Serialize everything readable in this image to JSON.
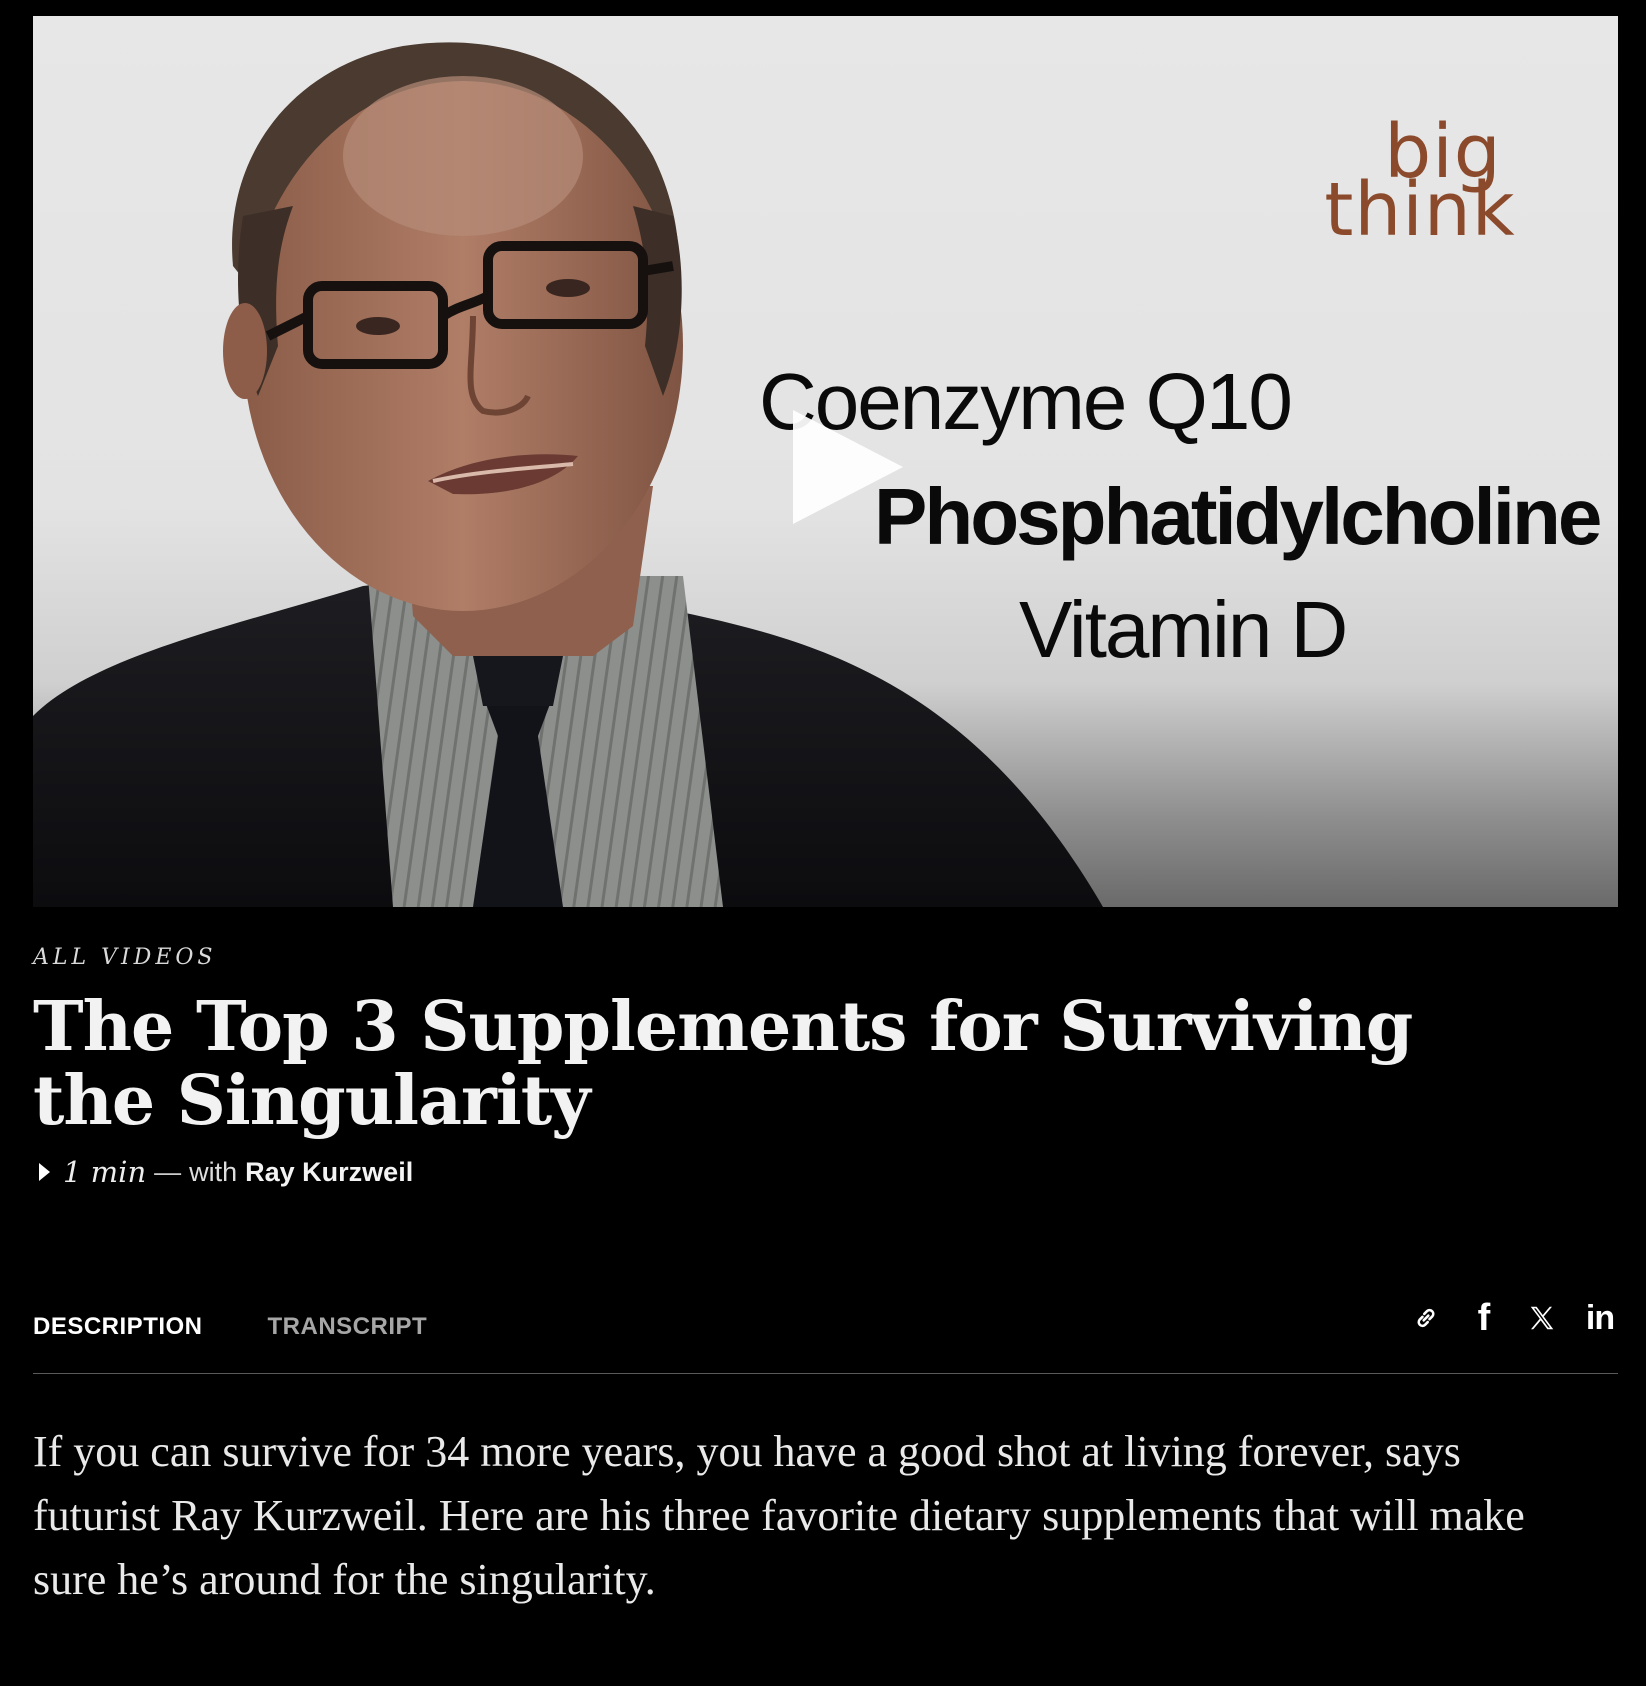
{
  "video": {
    "logo_line1": "big",
    "logo_line2": "think",
    "overlay_lines": [
      "Coenzyme Q10",
      "Phosphatidylcholine",
      "Vitamin D"
    ]
  },
  "article": {
    "category": "All Videos",
    "title": "The Top 3 Supplements for Surviving the Singularity",
    "duration": "1 min",
    "dash": "—",
    "with_label": "with",
    "author": "Ray Kurzweil"
  },
  "tabs": [
    {
      "label": "DESCRIPTION",
      "active": true
    },
    {
      "label": "TRANSCRIPT",
      "active": false
    }
  ],
  "share": {
    "facebook_glyph": "f",
    "linkedin_glyph": "in",
    "icons": [
      "link-icon",
      "facebook-icon",
      "x-icon",
      "linkedin-icon"
    ]
  },
  "description": "If you can survive for 34 more years, you have a good shot at living forever, says futurist Ray Kurzweil. Here are his three favorite dietary supplements that will make sure he’s around for the singularity.",
  "colors": {
    "background": "#000000",
    "text": "#ffffff",
    "muted": "#a6a6a6",
    "logo": "#8b4a2c"
  }
}
